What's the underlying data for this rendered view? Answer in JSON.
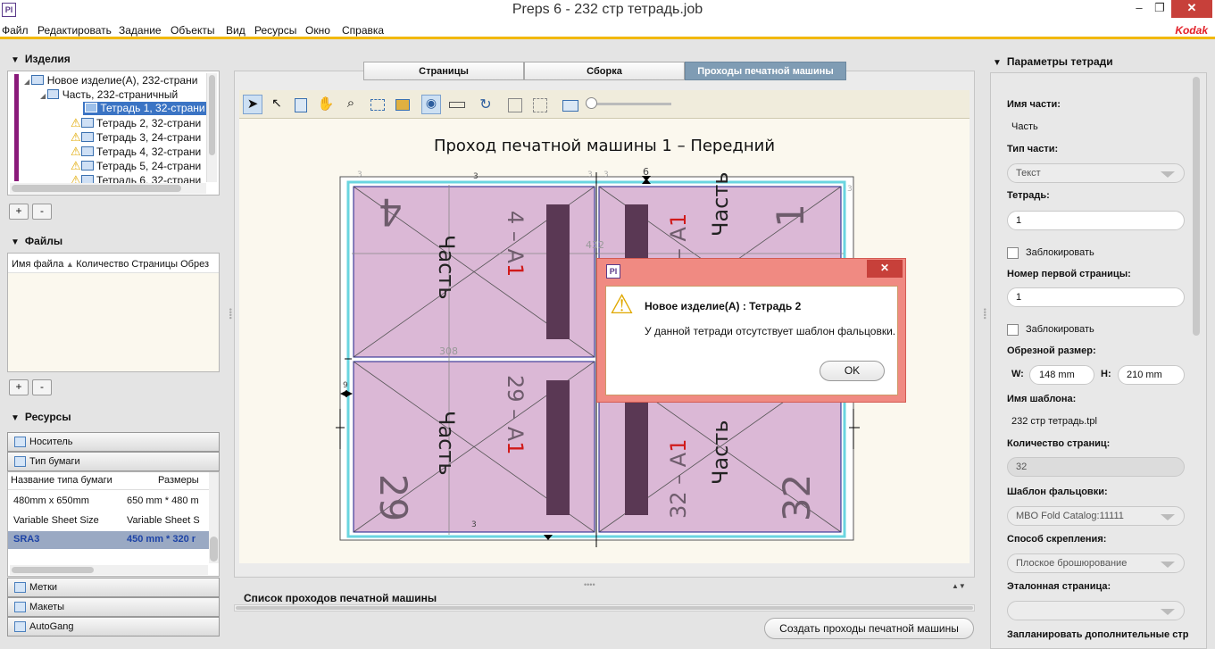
{
  "window": {
    "title": "Preps 6 - 232 стр тетрадь.job",
    "min": "–",
    "max": "❐",
    "close": "✕"
  },
  "menu": [
    "Файл",
    "Редактировать",
    "Задание",
    "Объекты",
    "Вид",
    "Ресурсы",
    "Окно",
    "Справка"
  ],
  "brand": "Kodak",
  "products": {
    "header": "Изделия",
    "items": [
      "Новое изделие(A), 232-страни",
      "Часть, 232-страничный",
      "Тетрадь 1, 32-страни",
      "Тетрадь 2, 32-страни",
      "Тетрадь 3, 24-страни",
      "Тетрадь 4, 32-страни",
      "Тетрадь 5, 24-страни",
      "Тетрадь 6, 32-страни"
    ],
    "add": "+",
    "remove": "-"
  },
  "files": {
    "header": "Файлы",
    "columns": [
      "Имя файла",
      "Количество",
      "Страницы",
      "Обрез"
    ],
    "add": "+",
    "remove": "-"
  },
  "resources": {
    "header": "Ресурсы",
    "media": "Носитель",
    "paper_type": "Тип бумаги",
    "columns": [
      "Название типа бумаги",
      "Размеры"
    ],
    "rows": [
      [
        "480mm x 650mm",
        "650 mm * 480 m"
      ],
      [
        "Variable Sheet Size",
        "Variable Sheet S"
      ],
      [
        "SRA3",
        "450 mm * 320 r"
      ]
    ],
    "marks": "Метки",
    "layouts": "Макеты",
    "autogang": "AutoGang"
  },
  "tabs": [
    "Страницы",
    "Сборка",
    "Проходы печатной машины"
  ],
  "sheet": {
    "title": "Проход печатной машины 1 – Передний",
    "dim_w": "432",
    "dim_h": "308",
    "gutter": "6",
    "margin_small": "3",
    "margin_left": "9",
    "pages": [
      {
        "num": "4",
        "label": "Часть",
        "code": "4 – A1"
      },
      {
        "num": "1",
        "label": "Часть",
        "code": "1 – A1"
      },
      {
        "num": "29",
        "label": "Часть",
        "code": "29 – A1"
      },
      {
        "num": "32",
        "label": "Часть",
        "code": "32 – A1"
      }
    ]
  },
  "bottom": {
    "list_title": "Список проходов печатной машины",
    "create_button": "Создать проходы печатной машины"
  },
  "dialog": {
    "title": "Новое изделие(A) : Тетрадь 2",
    "message": "У данной тетради отсутствует шаблон фальцовки.",
    "ok": "OK",
    "close": "✕"
  },
  "params": {
    "header": "Параметры тетради",
    "part_name_label": "Имя части:",
    "part_name": "Часть",
    "part_type_label": "Тип части:",
    "part_type": "Текст",
    "signature_label": "Тетрадь:",
    "signature": "1",
    "lock1": "Заблокировать",
    "first_page_label": "Номер первой страницы:",
    "first_page": "1",
    "lock2": "Заблокировать",
    "trim_label": "Обрезной размер:",
    "w_label": "W:",
    "w": "148 mm",
    "h_label": "H:",
    "h": "210 mm",
    "template_label": "Имя шаблона:",
    "template": "232 стр тетрадь.tpl",
    "pages_label": "Количество страниц:",
    "pages": "32",
    "fold_label": "Шаблон фальцовки:",
    "fold": "MBO Fold Catalog:11111",
    "binding_label": "Способ скрепления:",
    "binding": "Плоское брошюрование",
    "ref_page_label": "Эталонная страница:",
    "ref_page": "",
    "extra_label": "Запланировать дополнительные стр"
  }
}
